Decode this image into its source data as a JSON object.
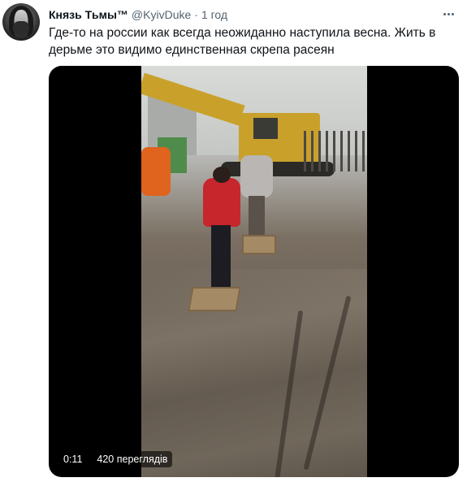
{
  "tweet": {
    "author_name": "Князь Тьмы™",
    "handle": "@KyivDuke",
    "separator": "·",
    "time": "1 год",
    "text_line1": "Где-то на россии как всегда неожиданно наступила весна. Жить в",
    "text_line2": "дерьме это видимо единственная скрепа расеян"
  },
  "video": {
    "duration": "0:11",
    "views": "420 переглядів"
  },
  "icons": {
    "more": "more-horizontal-icon"
  }
}
